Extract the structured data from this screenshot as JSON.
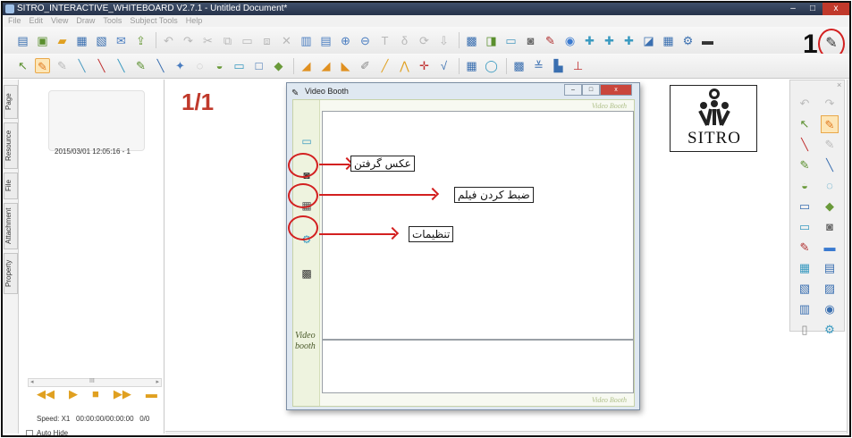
{
  "window": {
    "title": "SITRO_INTERACTIVE_WHITEBOARD V2.7.1 - Untitled Document*",
    "buttons": {
      "minimize": "–",
      "maximize": "□",
      "close": "x"
    }
  },
  "menu": [
    "File",
    "Edit",
    "View",
    "Draw",
    "Tools",
    "Subject Tools",
    "Help"
  ],
  "toolbar1_icons": [
    "new-icon",
    "open-icon",
    "folder-icon",
    "save-icon",
    "import-icon",
    "email-icon",
    "export-icon",
    "undo-icon",
    "redo-icon",
    "cut-icon",
    "copy-icon",
    "paste-icon",
    "clone-icon",
    "delete-icon",
    "page-icon",
    "page-add-icon",
    "zoom-in-icon",
    "zoom-out-icon",
    "text-icon",
    "text2-icon",
    "rotate-icon",
    "snap-icon",
    "screen-icon",
    "blank-icon",
    "record-icon",
    "camera-icon",
    "magic-pen-icon",
    "spotlight-icon",
    "vote-icon",
    "vote2-icon",
    "vote3-icon",
    "database-icon",
    "book-icon",
    "settings-icon",
    "keyboard-icon",
    "video-booth-icon"
  ],
  "toolbar2_icons": [
    "select-icon",
    "pen-icon",
    "pen2-icon",
    "brush-icon",
    "pencil-icon",
    "highlighter-icon",
    "crayon-icon",
    "calligraphy-icon",
    "magic-icon",
    "shape-icon",
    "fill-icon",
    "line-icon",
    "rect-icon",
    "eraser-icon",
    "ruler-icon",
    "protractor-icon",
    "triangle-icon",
    "pencil2-icon",
    "compass-icon",
    "axis-icon",
    "formula-icon",
    "table-icon",
    "ellipse-icon",
    "screen2-icon",
    "chart-icon",
    "graph-icon"
  ],
  "annotation_number": "1",
  "sidetabs": [
    "Page",
    "Resource",
    "File",
    "Attachment",
    "Property"
  ],
  "left_panel": {
    "thumbnail_label": "2015/03/01 12:05:16 - 1",
    "scroll_glyph": "III",
    "speed": "Speed: X1",
    "time": "00:00:00/00:00:00",
    "progress": "0/0",
    "auto_hide": "Auto Hide"
  },
  "canvas": {
    "page_number": "1/1",
    "logo_text": "SITRO"
  },
  "video_booth": {
    "title": "Video Booth",
    "brand_top": "Video Booth",
    "brand_bottom": "Video Booth",
    "side_brand": "Video booth",
    "callouts": {
      "photo": "عکس گرفتن",
      "record": "ضبط کردن فیلم",
      "settings": "تنظیمات"
    },
    "window_buttons": {
      "min": "–",
      "max": "□",
      "close": "x"
    }
  },
  "right_panel": {
    "close": "×",
    "icons": [
      "undo-icon",
      "redo-icon",
      "select-icon",
      "pen-icon",
      "pen2-icon",
      "eraser-icon",
      "brush-icon",
      "highlighter-icon",
      "fill-icon",
      "shape-icon",
      "rect-icon",
      "stamp-icon",
      "text-icon",
      "camera-icon",
      "magic-pen-icon",
      "record-icon",
      "keyboard-icon",
      "screen-icon",
      "import-icon",
      "export-icon",
      "page-icon",
      "spotlight-icon",
      "graph-icon",
      "settings-icon"
    ]
  },
  "colors": {
    "annotation_red": "#d32020",
    "page_number": "#c0392b",
    "title_bar": "#2f3b55"
  }
}
